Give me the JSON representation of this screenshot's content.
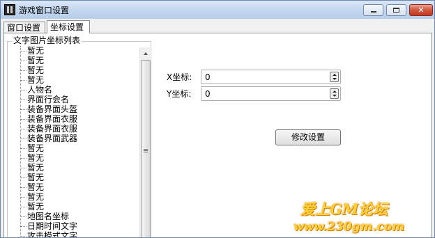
{
  "window": {
    "title": "游戏窗口设置",
    "controls": {
      "minimize": "minimize",
      "maximize": "maximize",
      "close": "✕"
    }
  },
  "tabs": [
    {
      "label": "窗口设置",
      "selected": false
    },
    {
      "label": "坐标设置",
      "selected": true
    }
  ],
  "tree": {
    "group_label": "文字图片坐标列表",
    "items": [
      "暂无",
      "暂无",
      "暂无",
      "暂无",
      "人物名",
      "界面行会名",
      "装备界面头盔",
      "装备界面衣服",
      "装备界面衣服",
      "装备界面武器",
      "暂无",
      "暂无",
      "暂无",
      "暂无",
      "暂无",
      "暂无",
      "暂无",
      "地图名坐标",
      "日期时间文字",
      "攻击模式文字"
    ]
  },
  "form": {
    "x_label": "X坐标:",
    "x_value": "0",
    "y_label": "Y坐标:",
    "y_value": "0",
    "submit_label": "修改设置"
  },
  "watermark": {
    "line1": "爱上GM论坛",
    "line2": "www.230gm.com"
  },
  "colors": {
    "titlebar": "#c2d6ee",
    "close_button": "#c0391f",
    "watermark": "#ffd23a"
  }
}
